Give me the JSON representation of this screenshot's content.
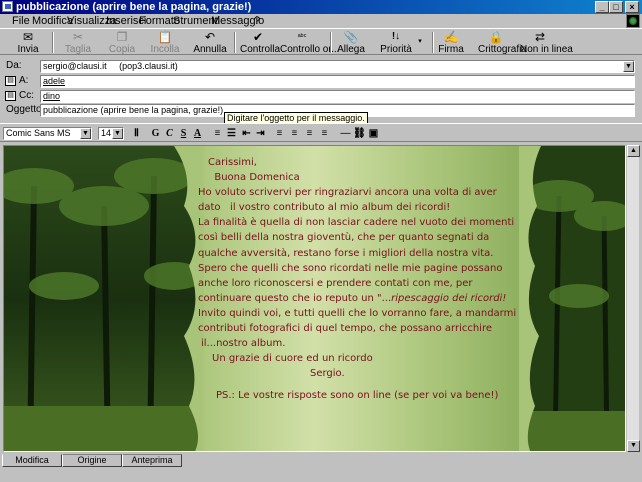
{
  "window": {
    "title": "pubblicazione (aprire bene la pagina, grazie!)"
  },
  "menu": [
    "File",
    "Modifica",
    "Visualizza",
    "Inserisci",
    "Formato",
    "Strumenti",
    "Messaggio",
    "?"
  ],
  "toolbar": [
    {
      "label": "Invia",
      "icon": "send-icon",
      "glyph": "✉",
      "enabled": true
    },
    {
      "label": "Taglia",
      "icon": "cut-icon",
      "glyph": "✂",
      "enabled": false
    },
    {
      "label": "Copia",
      "icon": "copy-icon",
      "glyph": "❐",
      "enabled": false
    },
    {
      "label": "Incolla",
      "icon": "paste-icon",
      "glyph": "📋",
      "enabled": false
    },
    {
      "label": "Annulla",
      "icon": "undo-icon",
      "glyph": "↶",
      "enabled": true
    },
    {
      "label": "Controlla",
      "icon": "check-names-icon",
      "glyph": "✔",
      "enabled": true
    },
    {
      "label": "Controllo or...",
      "icon": "spellcheck-icon",
      "glyph": "ᵃᵇᶜ",
      "enabled": true
    },
    {
      "label": "Allega",
      "icon": "attach-icon",
      "glyph": "📎",
      "enabled": true
    },
    {
      "label": "Priorità",
      "icon": "priority-icon",
      "glyph": "!↓",
      "enabled": true
    },
    {
      "label": "Firma",
      "icon": "sign-icon",
      "glyph": "✍",
      "enabled": true
    },
    {
      "label": "Crittografia",
      "icon": "encrypt-icon",
      "glyph": "🔒",
      "enabled": true
    },
    {
      "label": "Non in linea",
      "icon": "offline-icon",
      "glyph": "⇄",
      "enabled": true
    }
  ],
  "header": {
    "from_label": "Da:",
    "from_value": "sergio@clausi.it     (pop3.clausi.it)",
    "to_label": "A:",
    "to_value": "adele",
    "cc_label": "Cc:",
    "cc_value": "dino",
    "subject_label": "Oggetto:",
    "subject_value": "pubblicazione (aprire bene la pagina, grazie!)",
    "tooltip": "Digitare l'oggetto per il messaggio."
  },
  "format": {
    "font": "Comic Sans MS",
    "size": "14"
  },
  "letter": [
    "Carissimi,",
    "  Buona Domenica",
    "Ho voluto scrivervi per ringraziarvi ancora una volta di aver",
    "dato   il vostro contributo al mio album dei ricordi!",
    "La finalità è quella di non lasciar cadere nel vuoto dei momenti",
    "così belli della nostra gioventù, che per quanto segnati da",
    "qualche avversità, restano forse i migliori della nostra vita.",
    "Spero che quelli che sono ricordati nelle mie pagine possano",
    "anche loro riconoscersi e prendere contati con me, per",
    "continuare questo che io reputo un \"...",
    "ripescaggio dei ricordi!",
    "Invito quindi voi, e tutti quelli che lo vorranno fare, a mandarmi",
    "contributi fotografici di quel tempo, che possano arricchire",
    "il...nostro album.",
    "Un grazie di cuore ed un ricordo",
    "Sergio.",
    "PS.: Le vostre risposte sono on line (se per voi va bene!)"
  ],
  "tabs": [
    "Modifica",
    "Origine",
    "Anteprima"
  ]
}
